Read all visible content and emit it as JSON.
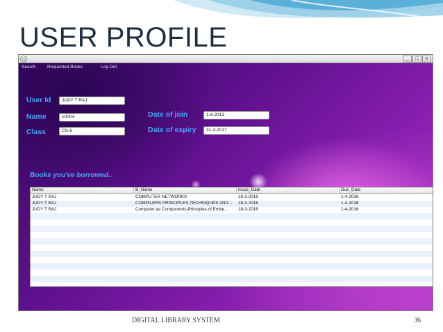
{
  "slide": {
    "title": "USER PROFILE",
    "footer": "DIGITAL LIBRARY SYSTEM",
    "page_number": "36"
  },
  "window": {
    "menu": [
      "Search",
      "Requested Books",
      "Log Out"
    ],
    "buttons": {
      "minimize": "_",
      "maximize": "□",
      "close": "x"
    }
  },
  "profile": {
    "user_id_label": "User Id",
    "user_id_value": "JUDY T RAJ",
    "name_label": "Name",
    "name_value": "10004",
    "class_label": "Class",
    "class_value": "CS-6",
    "doj_label": "Date of join",
    "doj_value": "1-8-2013",
    "doe_label": "Date of expiry",
    "doe_value": "31-3-2017"
  },
  "books": {
    "heading": "Books you've borrowed..",
    "columns": [
      "Name",
      "B_Name",
      "Issue_Date",
      "Due_Date"
    ],
    "rows": [
      [
        "JUDY T RAJ",
        "COMPUTER NETWORKS",
        "18-3-2016",
        "1-4-2016"
      ],
      [
        "JUDY T RAJ",
        "COMPILERS PRINCIPLES,TECHNIQUES AND...",
        "18-3-2016",
        "1-4-2016"
      ],
      [
        "JUDY T RAJ",
        " Computer as Components-Principles of Embe...",
        "18-3-2016",
        "1-4-2016"
      ]
    ]
  },
  "colors": {
    "label_blue": "#4aa4ff",
    "window_purple": "#5a0f86",
    "row_stripe": "#e9f1fb"
  }
}
